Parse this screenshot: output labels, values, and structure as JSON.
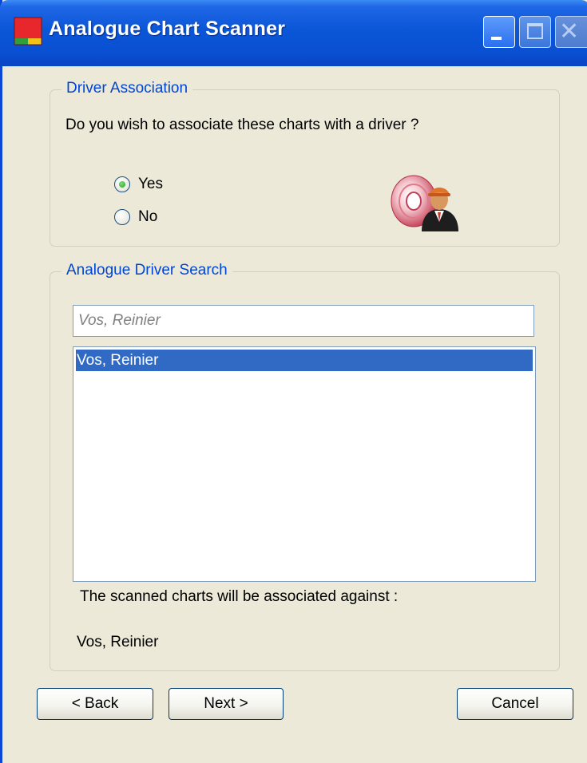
{
  "window": {
    "title": "Analogue Chart Scanner",
    "accent_color": "#0a56d8"
  },
  "title_buttons": {
    "minimize_icon": "minimize-icon",
    "maximize_icon": "maximize-icon",
    "close_icon": "close-icon"
  },
  "driver_association": {
    "legend": "Driver Association",
    "question": "Do you wish to associate these charts with a driver ?",
    "options": [
      {
        "label": "Yes",
        "checked": true
      },
      {
        "label": "No",
        "checked": false
      }
    ],
    "icon": "driver-disc-icon"
  },
  "driver_search": {
    "legend": "Analogue Driver Search",
    "search_placeholder": "Vos, Reinier",
    "results": [
      "Vos, Reinier"
    ],
    "selected_index": 0,
    "association_label": "The scanned charts will be associated against :",
    "association_value": "Vos, Reinier"
  },
  "buttons": {
    "back": "< Back",
    "next": "Next >",
    "cancel": "Cancel"
  }
}
